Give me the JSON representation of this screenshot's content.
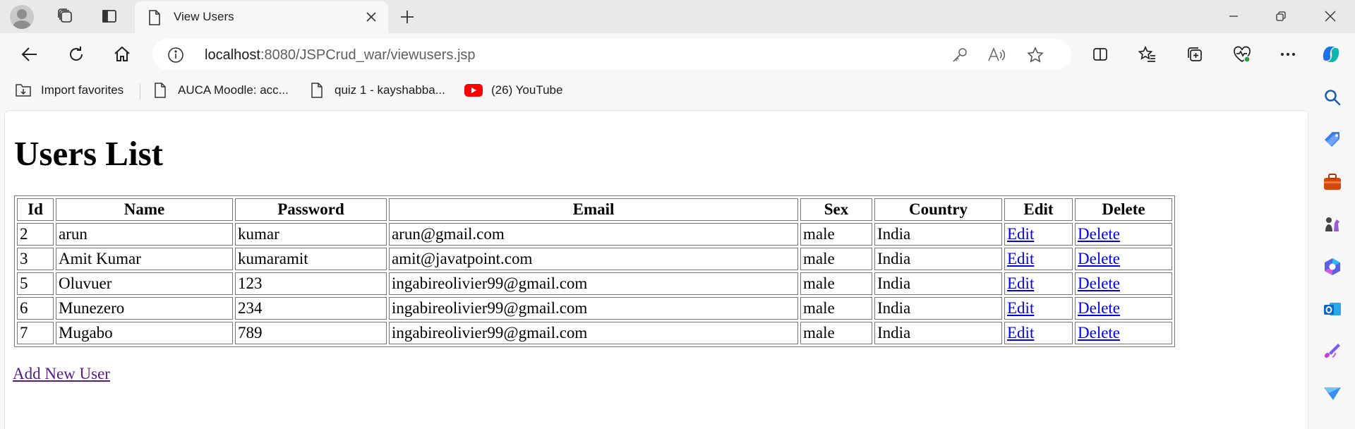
{
  "browser": {
    "tab": {
      "title": "View Users"
    },
    "address": {
      "host": "localhost",
      "rest": ":8080/JSPCrud_war/viewusers.jsp"
    },
    "favorites": [
      {
        "label": "Import favorites",
        "icon": "import-favorites-icon"
      },
      {
        "label": "AUCA Moodle: acc...",
        "icon": "page-icon"
      },
      {
        "label": "quiz 1 - kayshabba...",
        "icon": "page-icon"
      },
      {
        "label": "(26) YouTube",
        "icon": "youtube-icon"
      }
    ],
    "accent": "#1a73e8"
  },
  "page": {
    "title": "Users List",
    "table": {
      "headers": [
        "Id",
        "Name",
        "Password",
        "Email",
        "Sex",
        "Country",
        "Edit",
        "Delete"
      ],
      "rows": [
        {
          "id": "2",
          "name": "arun",
          "password": "kumar",
          "email": "arun@gmail.com",
          "sex": "male",
          "country": "India",
          "edit": "Edit",
          "delete": "Delete"
        },
        {
          "id": "3",
          "name": "Amit Kumar",
          "password": "kumaramit",
          "email": "amit@javatpoint.com",
          "sex": "male",
          "country": "India",
          "edit": "Edit",
          "delete": "Delete"
        },
        {
          "id": "5",
          "name": "Oluvuer",
          "password": "123",
          "email": "ingabireolivier99@gmail.com",
          "sex": "male",
          "country": "India",
          "edit": "Edit",
          "delete": "Delete"
        },
        {
          "id": "6",
          "name": "Munezero",
          "password": "234",
          "email": "ingabireolivier99@gmail.com",
          "sex": "male",
          "country": "India",
          "edit": "Edit",
          "delete": "Delete"
        },
        {
          "id": "7",
          "name": "Mugabo",
          "password": "789",
          "email": "ingabireolivier99@gmail.com",
          "sex": "male",
          "country": "India",
          "edit": "Edit",
          "delete": "Delete"
        }
      ]
    },
    "add_link": "Add New User",
    "link_color": "#0000ee",
    "visited_link_color": "#551a8b"
  }
}
